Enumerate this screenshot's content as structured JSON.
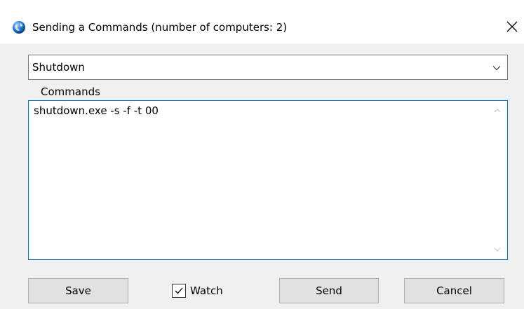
{
  "window": {
    "title": "Sending a Commands (number of computers: 2)",
    "icon": "globe-icon",
    "close_icon": "close-icon"
  },
  "command_select": {
    "value": "Shutdown",
    "icon": "chevron-down-icon"
  },
  "commands_group": {
    "label": "Commands",
    "text": "shutdown.exe -s -f -t 00"
  },
  "buttons": {
    "save": "Save",
    "send": "Send",
    "cancel": "Cancel"
  },
  "watch": {
    "label": "Watch",
    "checked": true
  },
  "colors": {
    "focus_border": "#0078d7",
    "dialog_bg": "#f0f0f0",
    "button_bg": "#e1e1e1"
  }
}
